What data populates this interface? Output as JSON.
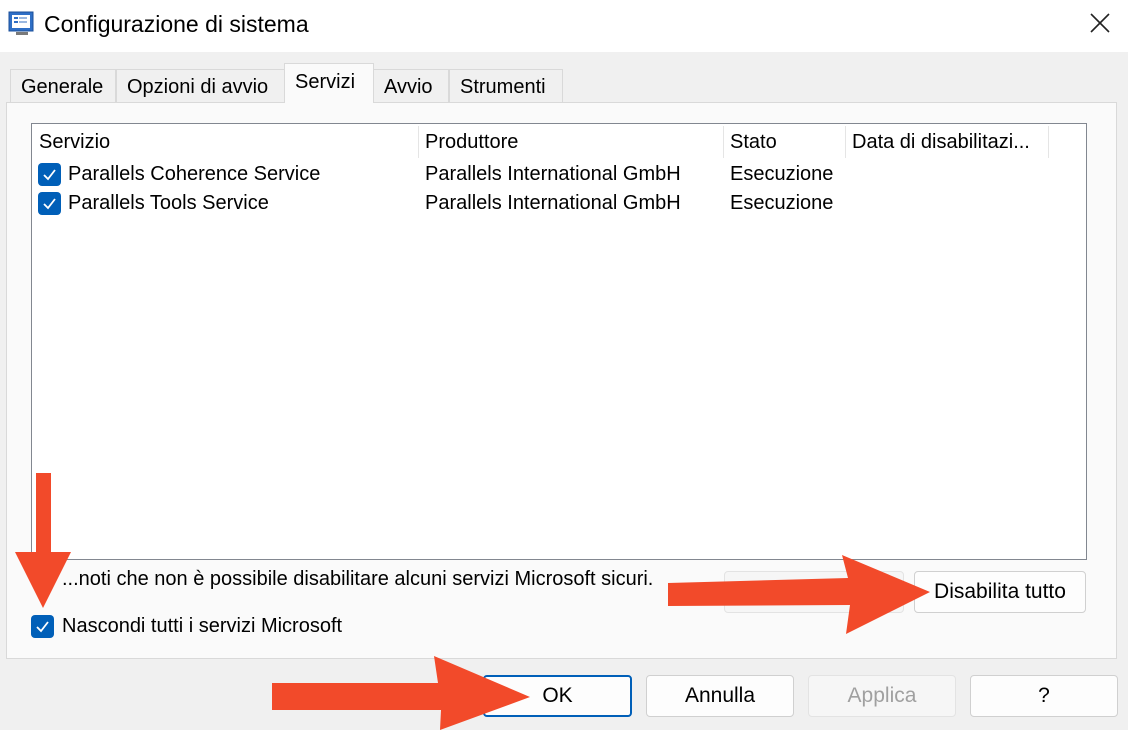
{
  "window": {
    "title": "Configurazione di sistema"
  },
  "tabs": [
    {
      "label": "Generale"
    },
    {
      "label": "Opzioni di avvio"
    },
    {
      "label": "Servizi"
    },
    {
      "label": "Avvio"
    },
    {
      "label": "Strumenti"
    }
  ],
  "active_tab": "Servizi",
  "services": {
    "columns": [
      "Servizio",
      "Produttore",
      "Stato",
      "Data di disabilitazi..."
    ],
    "rows": [
      {
        "checked": true,
        "name": "Parallels Coherence Service",
        "vendor": "Parallels International GmbH",
        "status": "Esecuzione",
        "disabled_date": ""
      },
      {
        "checked": true,
        "name": "Parallels Tools Service",
        "vendor": "Parallels International GmbH",
        "status": "Esecuzione",
        "disabled_date": ""
      }
    ]
  },
  "note": "...noti che non è possibile disabilitare alcuni servizi Microsoft sicuri.",
  "hide_microsoft": {
    "label": "Nascondi tutti i servizi Microsoft",
    "checked": true
  },
  "buttons": {
    "disable_all": "Disabilita tutto",
    "ok": "OK",
    "cancel": "Annulla",
    "apply": "Applica",
    "help": "?"
  },
  "colors": {
    "accent": "#005fb8",
    "annotation_arrow": "#f24a2a"
  }
}
